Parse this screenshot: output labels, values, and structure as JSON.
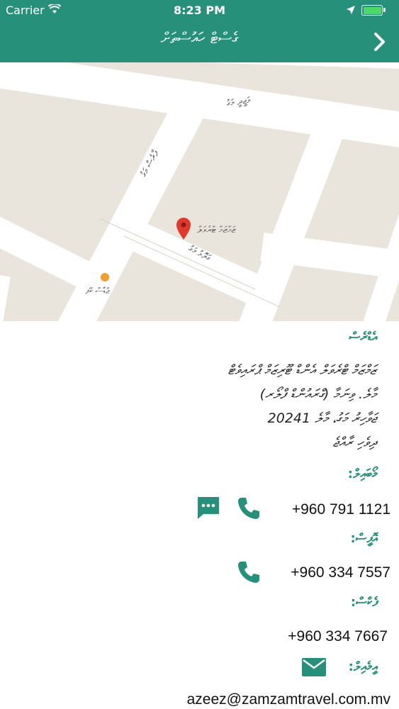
{
  "status_bar": {
    "carrier": "Carrier",
    "time": "8:23 PM",
    "battery_level": 1.0
  },
  "nav": {
    "title": "ގެސްޓް ހައުސްތަށް",
    "back_icon": "chevron-right-icon"
  },
  "map": {
    "street_labels": [
      "މަޖީދީ މަގު",
      "ފާރެސް މަގު",
      "ގަލޮޅު މަގު"
    ],
    "place_label": "ޒަމްޒަމް ޓްރެވަލް",
    "restaurant_label": "ޖުޑާސް ކޭފ"
  },
  "address": {
    "heading": "އެޑްރެސް",
    "lines": [
      "ޒަމްޒަމް ޓްރެވަލް އެންޑް ޓޫރިޒަމް ޕްރައިވެޓް",
      "މާލެ. ވިނަމާ (ގްރައުންޑް ފްލޯރ)",
      "ޖަވާހިރު މަގު، މާލެ 20241",
      "ދިވެހި ރާއްޖެ"
    ]
  },
  "mobile": {
    "heading": "މޯބައިލް:",
    "number": "+960 791 1121"
  },
  "office": {
    "heading": "އޮފީސް:",
    "number": "+960 334 7557"
  },
  "fax": {
    "heading": "ފެކްސް:",
    "number": "+960 334 7667"
  },
  "email": {
    "heading": "އީމެއިލް:",
    "address": "azeez@zamzamtravel.com.mv"
  },
  "colors": {
    "accent": "#26907a",
    "map_road": "#ffffff",
    "map_block": "#e9e5dc",
    "pin": "#e0382b"
  }
}
